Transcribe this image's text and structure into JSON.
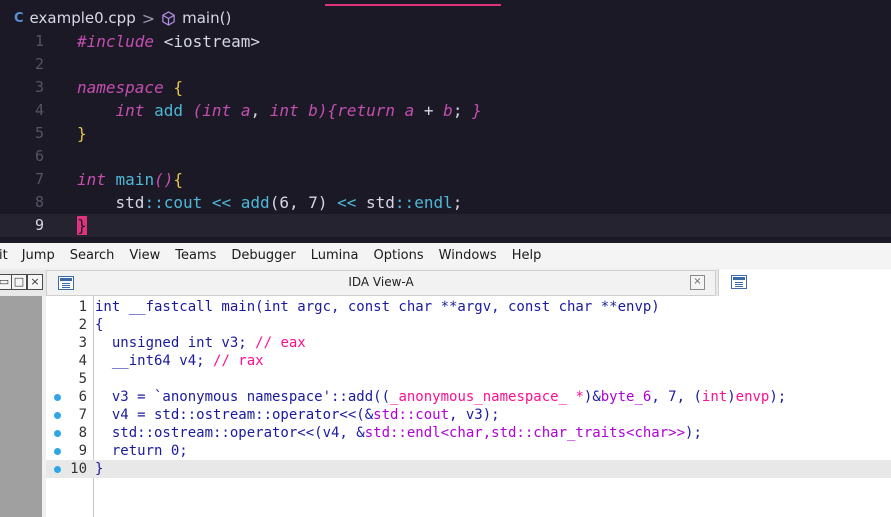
{
  "editor": {
    "breadcrumb": {
      "file_icon": "C",
      "file": "example0.cpp",
      "separator": ">",
      "symbol": "main()"
    },
    "lines": [
      {
        "n": "1",
        "parts": [
          [
            "kw-i",
            "#include"
          ],
          [
            "str",
            " <iostream>"
          ]
        ]
      },
      {
        "n": "2",
        "parts": []
      },
      {
        "n": "3",
        "parts": [
          [
            "kw-i",
            "namespace"
          ],
          [
            "punc",
            " "
          ],
          [
            "brace",
            "{"
          ]
        ]
      },
      {
        "n": "4",
        "parts": [
          [
            "punc",
            "    "
          ],
          [
            "kw-i",
            "int"
          ],
          [
            "punc",
            " "
          ],
          [
            "fn",
            "add"
          ],
          [
            "punc",
            " "
          ],
          [
            "kw-p",
            "("
          ],
          [
            "kw-i",
            "int"
          ],
          [
            "punc",
            " "
          ],
          [
            "var",
            "a"
          ],
          [
            "punc",
            ", "
          ],
          [
            "kw-i",
            "int"
          ],
          [
            "punc",
            " "
          ],
          [
            "var",
            "b"
          ],
          [
            "kw-p",
            ")"
          ],
          [
            "kw-p",
            "{"
          ],
          [
            "kw-i",
            "return"
          ],
          [
            "punc",
            " "
          ],
          [
            "var",
            "a"
          ],
          [
            "punc",
            " + "
          ],
          [
            "var",
            "b"
          ],
          [
            "punc",
            "; "
          ],
          [
            "kw-p",
            "}"
          ]
        ]
      },
      {
        "n": "5",
        "parts": [
          [
            "brace",
            "}"
          ]
        ]
      },
      {
        "n": "6",
        "parts": []
      },
      {
        "n": "7",
        "parts": [
          [
            "kw-i",
            "int"
          ],
          [
            "punc",
            " "
          ],
          [
            "fn",
            "main"
          ],
          [
            "kw-p",
            "()"
          ],
          [
            "brace",
            "{"
          ]
        ]
      },
      {
        "n": "8",
        "parts": [
          [
            "punc",
            "    std"
          ],
          [
            "op",
            "::"
          ],
          [
            "fn",
            "cout"
          ],
          [
            "punc",
            " "
          ],
          [
            "op",
            "<<"
          ],
          [
            "punc",
            " "
          ],
          [
            "fn",
            "add"
          ],
          [
            "punc",
            "(6, 7) "
          ],
          [
            "op",
            "<<"
          ],
          [
            "punc",
            " std"
          ],
          [
            "op",
            "::"
          ],
          [
            "fn",
            "endl"
          ],
          [
            "punc",
            ";"
          ]
        ]
      },
      {
        "n": "9",
        "parts": [
          [
            "cursor-block",
            "}"
          ]
        ],
        "current": true
      }
    ]
  },
  "ida": {
    "menu": [
      "it",
      "Jump",
      "Search",
      "View",
      "Teams",
      "Debugger",
      "Lumina",
      "Options",
      "Windows",
      "Help"
    ],
    "tab_title": "IDA View-A",
    "tab_close": "×",
    "win_buttons": [
      "▭",
      "□",
      "×"
    ],
    "lines": [
      {
        "n": "1",
        "dot": false,
        "parts": [
          [
            "c-kw",
            "int __fastcall main(int argc, const char **argv, const char **envp)"
          ]
        ]
      },
      {
        "n": "2",
        "dot": false,
        "parts": [
          [
            "c-pl",
            "{"
          ]
        ]
      },
      {
        "n": "3",
        "dot": false,
        "parts": [
          [
            "c-kw",
            "  unsigned int v3; "
          ],
          [
            "c-cm",
            "// eax"
          ]
        ]
      },
      {
        "n": "4",
        "dot": false,
        "parts": [
          [
            "c-kw",
            "  __int64 v4; "
          ],
          [
            "c-cm",
            "// rax"
          ]
        ]
      },
      {
        "n": "5",
        "dot": false,
        "parts": []
      },
      {
        "n": "6",
        "dot": true,
        "parts": [
          [
            "c-kw",
            "  v3 = `anonymous namespace'::add(("
          ],
          [
            "c-gl",
            "_anonymous_namespace_ *"
          ],
          [
            "c-kw",
            ")&"
          ],
          [
            "c-mg",
            "byte_6"
          ],
          [
            "c-kw",
            ", 7, ("
          ],
          [
            "c-gl",
            "int"
          ],
          [
            "c-kw",
            ")"
          ],
          [
            "c-gl",
            "envp"
          ],
          [
            "c-kw",
            ");"
          ]
        ]
      },
      {
        "n": "7",
        "dot": true,
        "parts": [
          [
            "c-kw",
            "  v4 = std::ostream::operator<<(&"
          ],
          [
            "c-mg",
            "std::cout"
          ],
          [
            "c-kw",
            ", v3);"
          ]
        ]
      },
      {
        "n": "8",
        "dot": true,
        "parts": [
          [
            "c-kw",
            "  std::ostream::operator<<(v4, &"
          ],
          [
            "c-mg",
            "std::endl<char,std::char_traits<char>>"
          ],
          [
            "c-kw",
            ");"
          ]
        ]
      },
      {
        "n": "9",
        "dot": true,
        "parts": [
          [
            "c-kw",
            "  return 0;"
          ]
        ]
      },
      {
        "n": "10",
        "dot": true,
        "parts": [
          [
            "c-pl",
            "}"
          ]
        ],
        "highlight": true
      }
    ]
  }
}
